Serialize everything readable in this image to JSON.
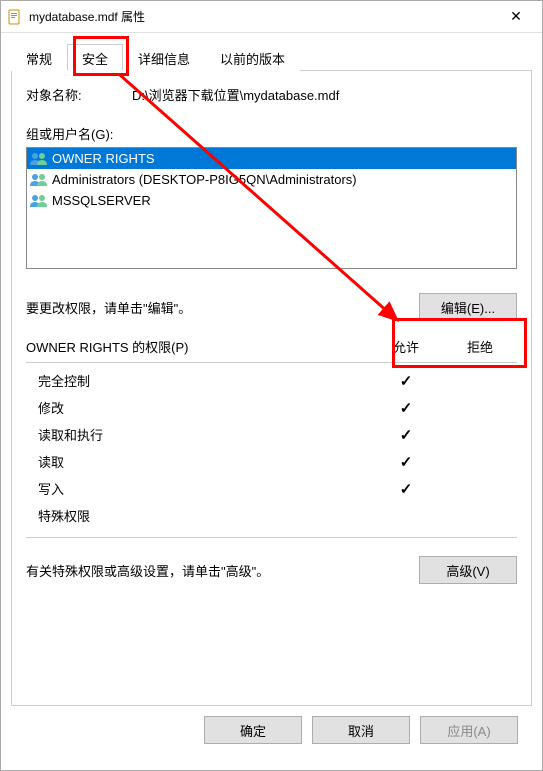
{
  "window": {
    "title": "mydatabase.mdf 属性"
  },
  "tabs": {
    "general": "常规",
    "security": "安全",
    "details": "详细信息",
    "previous": "以前的版本"
  },
  "object": {
    "label": "对象名称:",
    "value": "D:\\浏览器下载位置\\mydatabase.mdf"
  },
  "groups": {
    "label": "组或用户名(G):",
    "items": [
      {
        "name": "OWNER RIGHTS",
        "selected": true
      },
      {
        "name": "Administrators (DESKTOP-P8IG5QN\\Administrators)",
        "selected": false
      },
      {
        "name": "MSSQLSERVER",
        "selected": false
      }
    ]
  },
  "editHint": "要更改权限，请单击\"编辑\"。",
  "editButton": "编辑(E)...",
  "permHeader": {
    "title": "OWNER RIGHTS 的权限(P)",
    "allow": "允许",
    "deny": "拒绝"
  },
  "permissions": [
    {
      "name": "完全控制",
      "allow": "✓",
      "deny": ""
    },
    {
      "name": "修改",
      "allow": "✓",
      "deny": ""
    },
    {
      "name": "读取和执行",
      "allow": "✓",
      "deny": ""
    },
    {
      "name": "读取",
      "allow": "✓",
      "deny": ""
    },
    {
      "name": "写入",
      "allow": "✓",
      "deny": ""
    },
    {
      "name": "特殊权限",
      "allow": "",
      "deny": ""
    }
  ],
  "advHint": "有关特殊权限或高级设置，请单击\"高级\"。",
  "advButton": "高级(V)",
  "buttons": {
    "ok": "确定",
    "cancel": "取消",
    "apply": "应用(A)"
  }
}
